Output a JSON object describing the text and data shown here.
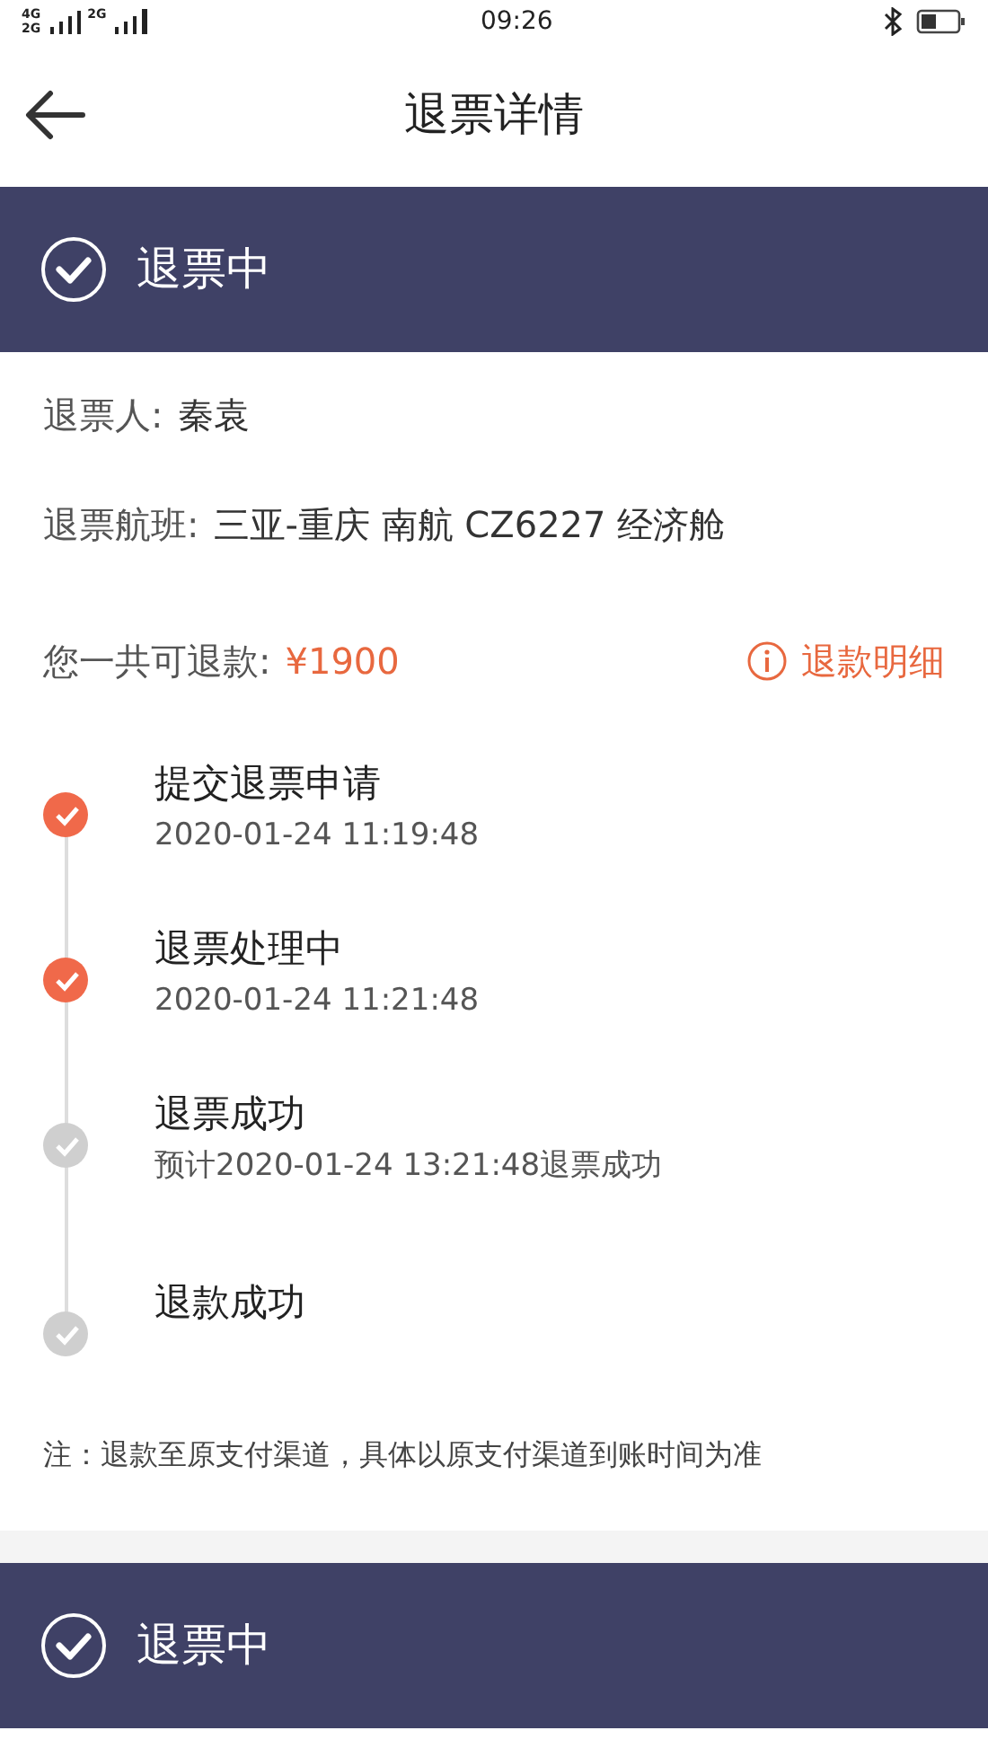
{
  "status_bar": {
    "network_labels": [
      "4G",
      "2G",
      "2G"
    ],
    "time": "09:26"
  },
  "header": {
    "title": "退票详情"
  },
  "banners": [
    {
      "status": "退票中"
    },
    {
      "status": "退票中"
    }
  ],
  "info": [
    {
      "label": "退票人:",
      "value": "秦袁"
    },
    {
      "label": "退票航班:",
      "value": "三亚-重庆 南航 CZ6227 经济舱"
    }
  ],
  "refund": {
    "label": "您一共可退款:",
    "amount": "¥1900",
    "detail_link": "退款明细"
  },
  "steps": [
    {
      "title": "提交退票申请",
      "time": "2020-01-24 11:19:48",
      "done": true
    },
    {
      "title": "退票处理中",
      "time": "2020-01-24 11:21:48",
      "done": true
    },
    {
      "title": "退票成功",
      "time": "预计2020-01-24 13:21:48退票成功",
      "done": false
    },
    {
      "title": "退款成功",
      "done": false
    }
  ],
  "note": "注：退款至原支付渠道，具体以原支付渠道到账时间为准"
}
